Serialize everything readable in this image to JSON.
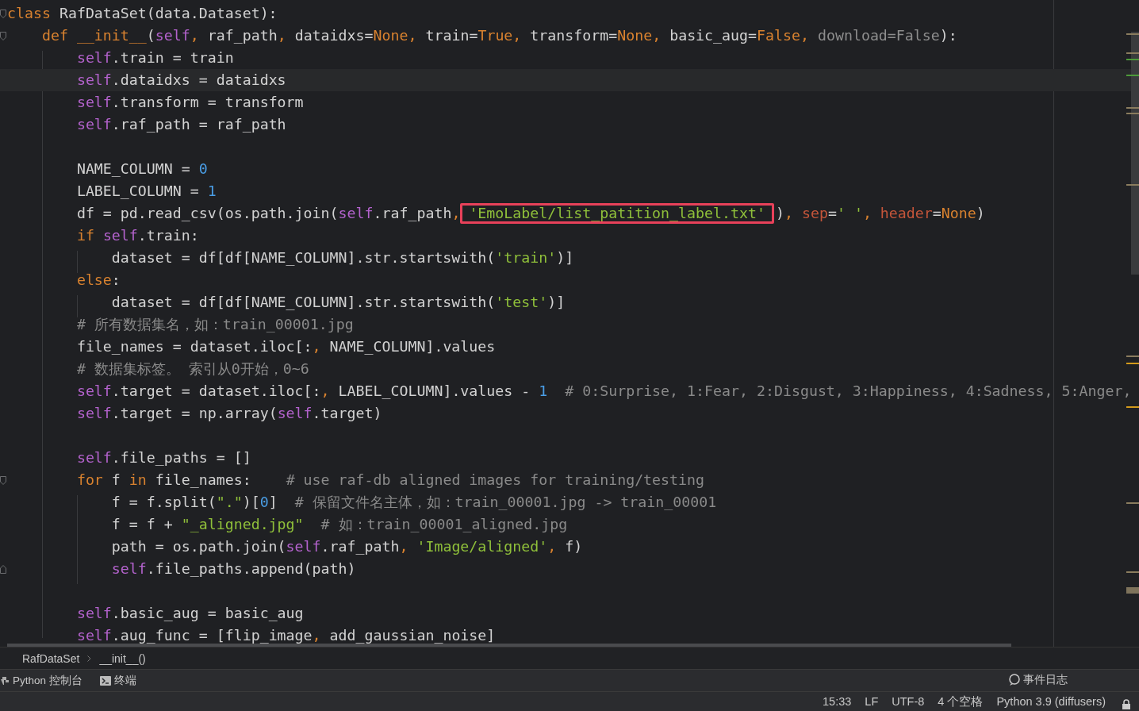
{
  "editor": {
    "lines": [
      {
        "current": false,
        "kind": "block-start",
        "tokens": [
          {
            "kind": "kw",
            "text": "class"
          },
          {
            "kind": "plain",
            "text": " RafDataSet(data.Dataset):"
          }
        ]
      },
      {
        "current": false,
        "kind": "block-start",
        "tokens": [
          {
            "kind": "kw",
            "text": "    def __init__"
          },
          {
            "kind": "plain",
            "text": "("
          },
          {
            "kind": "self",
            "text": "self"
          },
          {
            "kind": "kw",
            "text": ","
          },
          {
            "kind": "plain",
            "text": " raf_path"
          },
          {
            "kind": "kw",
            "text": ","
          },
          {
            "kind": "plain",
            "text": " dataidxs="
          },
          {
            "kind": "kw",
            "text": "None, "
          },
          {
            "kind": "plain",
            "text": "train="
          },
          {
            "kind": "kw",
            "text": "True, "
          },
          {
            "kind": "plain",
            "text": "transform="
          },
          {
            "kind": "kw",
            "text": "None, "
          },
          {
            "kind": "plain",
            "text": "basic_aug="
          },
          {
            "kind": "kw",
            "text": "False, "
          },
          {
            "kind": "unused",
            "text": "download=False"
          },
          {
            "kind": "plain",
            "text": "):"
          }
        ]
      },
      {
        "current": false,
        "kind": "code",
        "tokens": [
          {
            "kind": "self",
            "text": "        self"
          },
          {
            "kind": "plain",
            "text": ".train = train"
          }
        ]
      },
      {
        "current": true,
        "kind": "code",
        "tokens": [
          {
            "kind": "self",
            "text": "        self"
          },
          {
            "kind": "plain",
            "text": ".dataidxs = dataidxs"
          }
        ]
      },
      {
        "current": false,
        "kind": "code",
        "tokens": [
          {
            "kind": "self",
            "text": "        self"
          },
          {
            "kind": "plain",
            "text": ".transform = transform"
          }
        ]
      },
      {
        "current": false,
        "kind": "code",
        "tokens": [
          {
            "kind": "self",
            "text": "        self"
          },
          {
            "kind": "plain",
            "text": ".raf_path = raf_path"
          }
        ]
      },
      {
        "current": false,
        "kind": "blank"
      },
      {
        "current": false,
        "kind": "code",
        "tokens": [
          {
            "kind": "plain",
            "text": "        NAME_COLUMN = "
          },
          {
            "kind": "num",
            "text": "0"
          }
        ]
      },
      {
        "current": false,
        "kind": "code",
        "tokens": [
          {
            "kind": "plain",
            "text": "        LABEL_COLUMN = "
          },
          {
            "kind": "num",
            "text": "1"
          }
        ]
      },
      {
        "current": false,
        "kind": "code",
        "tokens": [
          {
            "kind": "plain",
            "text": "        df = pd.read_csv(os.path.join("
          },
          {
            "kind": "self",
            "text": "self"
          },
          {
            "kind": "plain",
            "text": ".raf_path"
          },
          {
            "kind": "kw",
            "text": ","
          },
          {
            "kind": "callout",
            "text": "'EmoLabel/list_patition_label.txt'"
          },
          {
            "kind": "plain",
            "text": ")"
          },
          {
            "kind": "kw",
            "text": ", "
          },
          {
            "kind": "kwarg",
            "text": "sep"
          },
          {
            "kind": "plain",
            "text": "="
          },
          {
            "kind": "str",
            "text": "' '"
          },
          {
            "kind": "kw",
            "text": ", "
          },
          {
            "kind": "kwarg",
            "text": "header"
          },
          {
            "kind": "plain",
            "text": "="
          },
          {
            "kind": "kw",
            "text": "None"
          },
          {
            "kind": "plain",
            "text": ")"
          }
        ]
      },
      {
        "current": false,
        "kind": "code",
        "tokens": [
          {
            "kind": "kw",
            "text": "        if "
          },
          {
            "kind": "self",
            "text": "self"
          },
          {
            "kind": "plain",
            "text": ".train:"
          }
        ]
      },
      {
        "current": false,
        "kind": "code",
        "tokens": [
          {
            "kind": "plain",
            "text": "            dataset = df[df[NAME_COLUMN].str.startswith("
          },
          {
            "kind": "str",
            "text": "'train'"
          },
          {
            "kind": "plain",
            "text": ")]"
          }
        ]
      },
      {
        "current": false,
        "kind": "code",
        "tokens": [
          {
            "kind": "kw",
            "text": "        else"
          },
          {
            "kind": "plain",
            "text": ":"
          }
        ]
      },
      {
        "current": false,
        "kind": "code",
        "tokens": [
          {
            "kind": "plain",
            "text": "            dataset = df[df[NAME_COLUMN].str.startswith("
          },
          {
            "kind": "str",
            "text": "'test'"
          },
          {
            "kind": "plain",
            "text": ")]"
          }
        ]
      },
      {
        "current": false,
        "kind": "code",
        "tokens": [
          {
            "kind": "comment",
            "text": "        # 所有数据集名，如：train_00001.jpg"
          }
        ]
      },
      {
        "current": false,
        "kind": "code",
        "tokens": [
          {
            "kind": "plain",
            "text": "        file_names = dataset.iloc[:"
          },
          {
            "kind": "kw",
            "text": ", "
          },
          {
            "kind": "plain",
            "text": "NAME_COLUMN].values"
          }
        ]
      },
      {
        "current": false,
        "kind": "code",
        "tokens": [
          {
            "kind": "comment",
            "text": "        # 数据集标签。 索引从0开始，0~6"
          }
        ]
      },
      {
        "current": false,
        "kind": "code",
        "tokens": [
          {
            "kind": "self",
            "text": "        self"
          },
          {
            "kind": "plain",
            "text": ".target = dataset.iloc[:"
          },
          {
            "kind": "kw",
            "text": ", "
          },
          {
            "kind": "plain",
            "text": "LABEL_COLUMN].values - "
          },
          {
            "kind": "num",
            "text": "1"
          },
          {
            "kind": "comment",
            "text": "  # 0:Surprise, 1:Fear, 2:Disgust, 3:Happiness, 4:Sadness, 5:Anger,"
          }
        ]
      },
      {
        "current": false,
        "kind": "code",
        "tokens": [
          {
            "kind": "self",
            "text": "        self"
          },
          {
            "kind": "plain",
            "text": ".target = np.array("
          },
          {
            "kind": "self",
            "text": "self"
          },
          {
            "kind": "plain",
            "text": ".target)"
          }
        ]
      },
      {
        "current": false,
        "kind": "blank"
      },
      {
        "current": false,
        "kind": "code",
        "tokens": [
          {
            "kind": "self",
            "text": "        self"
          },
          {
            "kind": "plain",
            "text": ".file_paths = []"
          }
        ]
      },
      {
        "current": false,
        "kind": "block-start",
        "tokens": [
          {
            "kind": "kw",
            "text": "        for "
          },
          {
            "kind": "plain",
            "text": "f "
          },
          {
            "kind": "kw",
            "text": "in "
          },
          {
            "kind": "plain",
            "text": "file_names:"
          },
          {
            "kind": "comment",
            "text": "    # use raf-db aligned images for training/testing"
          }
        ]
      },
      {
        "current": false,
        "kind": "code",
        "tokens": [
          {
            "kind": "plain",
            "text": "            f = f.split("
          },
          {
            "kind": "str",
            "text": "\".\""
          },
          {
            "kind": "plain",
            "text": ")["
          },
          {
            "kind": "num",
            "text": "0"
          },
          {
            "kind": "plain",
            "text": "]"
          },
          {
            "kind": "comment",
            "text": "  # 保留文件名主体，如：train_00001.jpg -> train_00001"
          }
        ]
      },
      {
        "current": false,
        "kind": "code",
        "tokens": [
          {
            "kind": "plain",
            "text": "            f = f + "
          },
          {
            "kind": "str",
            "text": "\"_aligned.jpg\""
          },
          {
            "kind": "comment",
            "text": "  # 如：train_00001_aligned.jpg"
          }
        ]
      },
      {
        "current": false,
        "kind": "code",
        "tokens": [
          {
            "kind": "plain",
            "text": "            path = os.path.join("
          },
          {
            "kind": "self",
            "text": "self"
          },
          {
            "kind": "plain",
            "text": ".raf_path"
          },
          {
            "kind": "kw",
            "text": ", "
          },
          {
            "kind": "str",
            "text": "'Image/aligned'"
          },
          {
            "kind": "kw",
            "text": ", "
          },
          {
            "kind": "plain",
            "text": "f)"
          }
        ]
      },
      {
        "current": false,
        "kind": "block-end",
        "tokens": [
          {
            "kind": "self",
            "text": "            self"
          },
          {
            "kind": "plain",
            "text": ".file_paths.append(path)"
          }
        ]
      },
      {
        "current": false,
        "kind": "blank"
      },
      {
        "current": false,
        "kind": "code",
        "tokens": [
          {
            "kind": "self",
            "text": "        self"
          },
          {
            "kind": "plain",
            "text": ".basic_aug = basic_aug"
          }
        ]
      },
      {
        "current": false,
        "kind": "code",
        "tokens": [
          {
            "kind": "self",
            "text": "        self"
          },
          {
            "kind": "plain",
            "text": ".aug_func = [flip_image"
          },
          {
            "kind": "kw",
            "text": ", "
          },
          {
            "kind": "plain",
            "text": "add_gaussian_noise]"
          }
        ]
      }
    ]
  },
  "breadcrumbs": [
    "RafDataSet",
    "__init__()"
  ],
  "tool_tabs": [
    {
      "kind": "python",
      "label": "Python 控制台"
    },
    {
      "kind": "terminal",
      "label": "终端"
    }
  ],
  "event_log": {
    "label": "事件日志"
  },
  "status_bar": {
    "items": [
      "15:33",
      "LF",
      "UTF-8",
      "4 个空格",
      "Python 3.9 (diffusers)"
    ]
  }
}
